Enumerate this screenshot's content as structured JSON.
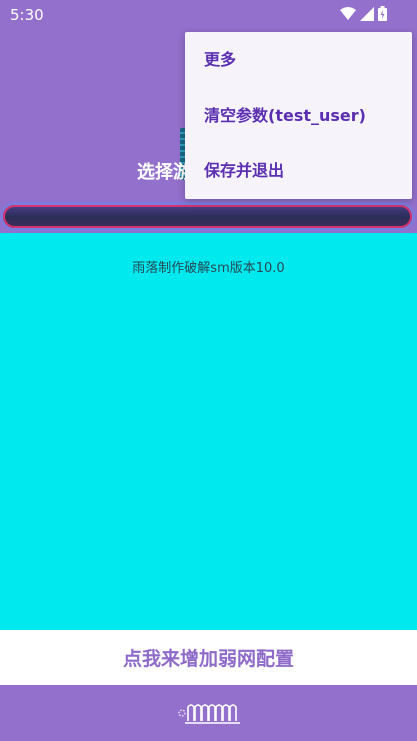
{
  "status_bar": {
    "time": "5:30",
    "icons": [
      "wifi-icon",
      "signal-icon",
      "battery-icon"
    ]
  },
  "header": {
    "title": "选择游"
  },
  "progress": {
    "fraction": 0
  },
  "content": {
    "version_text": "雨落制作破解sm版本10.0"
  },
  "add_button": {
    "label": "点我来增加弱网配置"
  },
  "menu": {
    "items": [
      {
        "label": "更多"
      },
      {
        "label": "清空参数(test_user)"
      },
      {
        "label": "保存并退出"
      }
    ]
  },
  "colors": {
    "primary": "#9370cc",
    "content_bg": "#00e9ef",
    "menu_text": "#5b2fb0",
    "button_text": "#8e6ac9"
  }
}
